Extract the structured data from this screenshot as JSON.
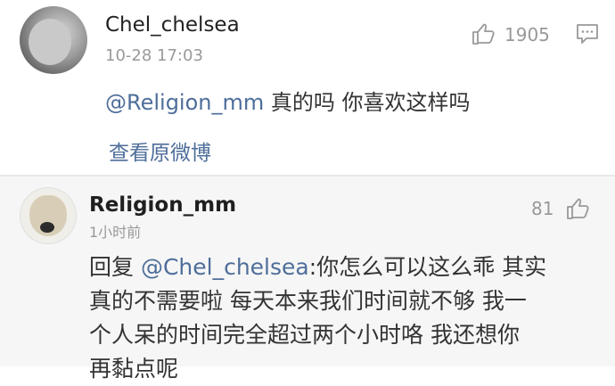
{
  "comment1": {
    "username": "Chel_chelsea",
    "timestamp": "10-28 17:03",
    "like_count": "1905",
    "mention": "@Religion_mm",
    "text": " 真的吗 你喜欢这样吗",
    "view_original_label": "查看原微博"
  },
  "comment2": {
    "username": "Religion_mm",
    "timestamp": "1小时前",
    "like_count": "81",
    "reply_prefix": "回复 ",
    "mention": "@Chel_chelsea",
    "line1_rest": ":你怎么可以这么乖 其实",
    "line2": "真的不需要啦 每天本来我们时间就不够 我一",
    "line3": "个人呆的时间完全超过两个小时咯 我还想你",
    "line4": "再黏点呢"
  },
  "colors": {
    "mention": "#4e6e9a",
    "meta_gray": "#9a9a9a",
    "reply_background": "#f6f6f6"
  },
  "icons": [
    "thumbs-up-icon",
    "comment-icon"
  ]
}
